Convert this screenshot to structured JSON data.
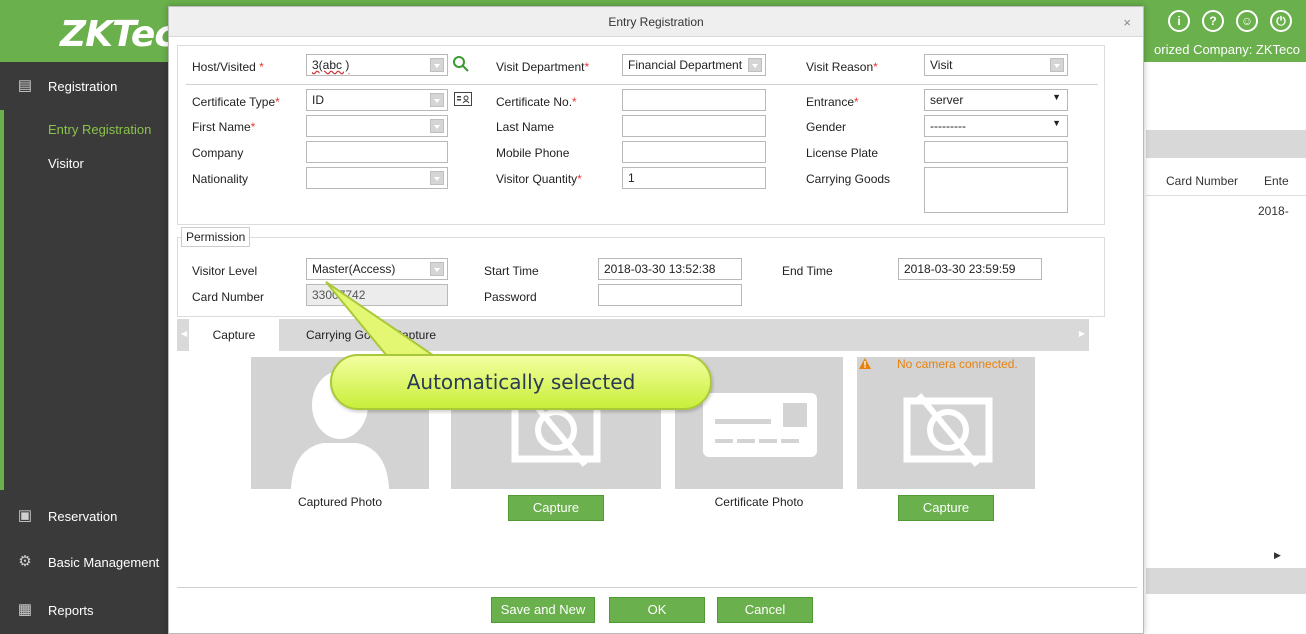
{
  "app": {
    "logo": "ZKTeco",
    "authorized_company": "orized Company: ZKTeco",
    "top_icons": [
      "info-icon",
      "help-icon",
      "user-icon",
      "power-icon"
    ]
  },
  "sidebar": {
    "registration": "Registration",
    "entry_registration": "Entry Registration",
    "visitor": "Visitor",
    "reservation": "Reservation",
    "basic_management": "Basic Management",
    "reports": "Reports"
  },
  "background_table": {
    "col_card_number": "Card Number",
    "col_enter": "Ente",
    "cell_date": "2018-"
  },
  "dialog": {
    "title": "Entry Registration",
    "close": "×",
    "host_label": "Host/Visited",
    "host_value": "3(abc )",
    "visit_department_label": "Visit Department",
    "visit_department_value": "Financial Department",
    "visit_reason_label": "Visit Reason",
    "visit_reason_value": "Visit",
    "certificate_type_label": "Certificate Type",
    "certificate_type_value": "ID",
    "certificate_no_label": "Certificate No.",
    "certificate_no_value": "",
    "entrance_label": "Entrance",
    "entrance_value": "server",
    "first_name_label": "First Name",
    "first_name_value": "",
    "last_name_label": "Last Name",
    "last_name_value": "",
    "gender_label": "Gender",
    "gender_value": "---------",
    "company_label": "Company",
    "company_value": "",
    "mobile_phone_label": "Mobile Phone",
    "mobile_phone_value": "",
    "license_plate_label": "License Plate",
    "license_plate_value": "",
    "nationality_label": "Nationality",
    "nationality_value": "",
    "visitor_quantity_label": "Visitor Quantity",
    "visitor_quantity_value": "1",
    "carrying_goods_label": "Carrying Goods",
    "carrying_goods_value": "",
    "required_mark": "*"
  },
  "permission": {
    "legend": "Permission",
    "visitor_level_label": "Visitor Level",
    "visitor_level_value": "Master(Access)",
    "start_time_label": "Start Time",
    "start_time_value": "2018-03-30 13:52:38",
    "end_time_label": "End Time",
    "end_time_value": "2018-03-30 23:59:59",
    "card_number_label": "Card Number",
    "card_number_value": "33007742",
    "password_label": "Password",
    "password_value": ""
  },
  "tabs": {
    "capture": "Capture",
    "carrying_goods_capture": "Carrying Goods Capture"
  },
  "photos": {
    "captured_photo_label": "Captured Photo",
    "certificate_photo_label": "Certificate Photo",
    "capture_button_1": "Capture",
    "capture_button_2": "Capture",
    "no_camera_warning": "No camera connected."
  },
  "footer": {
    "save_and_new": "Save and New",
    "ok": "OK",
    "cancel": "Cancel"
  },
  "callout": {
    "text": "Automatically selected"
  },
  "colors": {
    "brand_green": "#6ab04c",
    "sidebar_bg": "#3a3a3a",
    "callout_fill": "#d8f25a",
    "warning": "#e8810c",
    "required": "#e53935"
  }
}
